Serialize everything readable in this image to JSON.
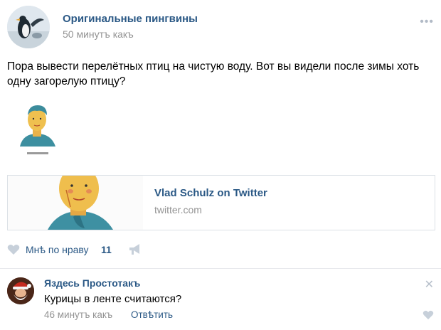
{
  "post": {
    "author": "Оригинальные пингвины",
    "time": "50 минутъ какъ",
    "text": "Пора вывести перелётных птиц на чистую воду. Вот вы видели после зимы хоть одну загорелую птицу?",
    "more_icon": "more-dots-icon"
  },
  "link": {
    "title": "Vlad Schulz on Twitter",
    "domain": "twitter.com"
  },
  "actions": {
    "like_label": "Мнѣ по нраву",
    "like_count": "11",
    "like_icon": "heart-icon",
    "share_icon": "megaphone-icon"
  },
  "comment": {
    "author": "Яздесь Простотакъ",
    "text": "Курицы в ленте считаются?",
    "time": "46 минутъ какъ",
    "reply_label": "Отвѣтить",
    "close_icon": "close-icon"
  },
  "colors": {
    "link_blue": "#2a5885",
    "meta_gray": "#939393",
    "icon_gray": "#b1bac6"
  }
}
